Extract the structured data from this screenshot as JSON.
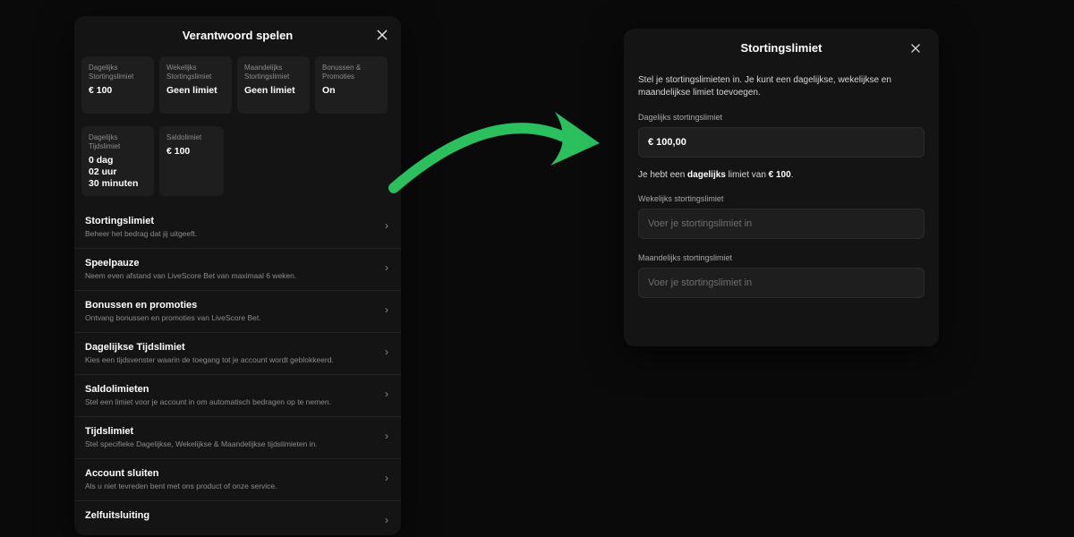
{
  "left": {
    "title": "Verantwoord spelen",
    "cards": [
      {
        "label": "Dagelijks Stortingslimiet",
        "value": "€ 100"
      },
      {
        "label": "Wekelijks Stortingslimiet",
        "value": "Geen limiet"
      },
      {
        "label": "Maandelijks Stortingslimiet",
        "value": "Geen limiet"
      },
      {
        "label": "Bonussen & Promoties",
        "value": "On"
      },
      {
        "label": "Dagelijks Tijdslimiet",
        "value": "0 dag\n02 uur\n30 minuten"
      },
      {
        "label": "Saldolimiet",
        "value": "€ 100"
      }
    ],
    "menu": [
      {
        "title": "Stortingslimiet",
        "sub": "Beheer het bedrag dat jij uitgeeft."
      },
      {
        "title": "Speelpauze",
        "sub": "Neem even afstand van LiveScore Bet van maximaal 6 weken."
      },
      {
        "title": "Bonussen en promoties",
        "sub": "Ontvang bonussen en promoties van LiveScore Bet."
      },
      {
        "title": "Dagelijkse Tijdslimiet",
        "sub": "Kies een tijdsvenster waarin de toegang tot je account wordt geblokkeerd."
      },
      {
        "title": "Saldolimieten",
        "sub": "Stel een limiet voor je account in om automatisch bedragen op te nemen."
      },
      {
        "title": "Tijdslimiet",
        "sub": "Stel specifieke Dagelijkse, Wekelijkse & Maandelijkse tijdslimieten in."
      },
      {
        "title": "Account sluiten",
        "sub": "Als u niet tevreden bent met ons product of onze service."
      },
      {
        "title": "Zelfuitsluiting",
        "sub": ""
      }
    ]
  },
  "right": {
    "title": "Stortingslimiet",
    "intro": "Stel je stortingslimieten in. Je kunt een dagelijkse, wekelijkse en maandelijkse limiet toevoegen.",
    "fields": {
      "daily_label": "Dagelijks stortingslimiet",
      "daily_value": "€ 100,00",
      "weekly_label": "Wekelijks stortingslimiet",
      "weekly_placeholder": "Voer je stortingslimiet in",
      "monthly_label": "Maandelijks stortingslimiet",
      "monthly_placeholder": "Voer je stortingslimiet in"
    },
    "note_prefix": "Je hebt een ",
    "note_bold1": "dagelijks",
    "note_mid": " limiet van ",
    "note_bold2": "€ 100",
    "note_suffix": "."
  },
  "arrow_color": "#2bbf5e"
}
